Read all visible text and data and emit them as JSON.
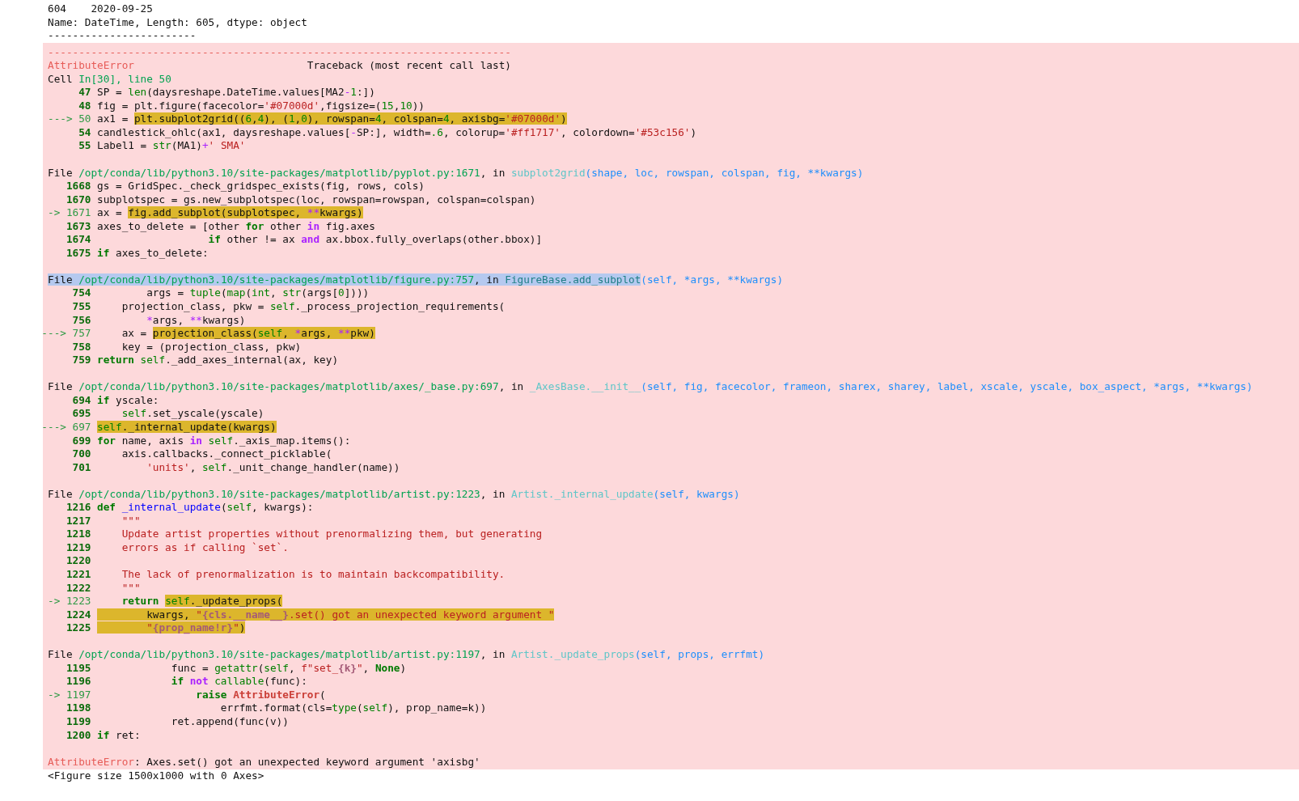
{
  "output_lines": [
    "604    2020-09-25",
    "Name: DateTime, Length: 605, dtype: object",
    "------------------------"
  ],
  "traceback": {
    "rule": "---------------------------------------------------------------------------",
    "header": [
      {
        "text": "AttributeError",
        "kind": "errname"
      },
      {
        "text": "                            Traceback (most recent call last)",
        "kind": "plain"
      }
    ],
    "frames": [
      {
        "location": [
          {
            "selected": false,
            "tokens": [
              {
                "text": "Cell ",
                "kind": "plain"
              },
              {
                "text": "In[30], line 50",
                "kind": "path"
              }
            ]
          }
        ],
        "lines": [
          {
            "number": "47",
            "current": false,
            "parts": [
              {
                "highlighted": false,
                "tokens": [
                  {
                    "text": "SP = ",
                    "kind": "plain"
                  },
                  {
                    "text": "len",
                    "kind": "builtin"
                  },
                  {
                    "text": "(daysreshape.DateTime.values[MA2",
                    "kind": "plain"
                  },
                  {
                    "text": "-",
                    "kind": "op"
                  },
                  {
                    "text": "1",
                    "kind": "number"
                  },
                  {
                    "text": ":])",
                    "kind": "plain"
                  }
                ]
              }
            ]
          },
          {
            "number": "48",
            "current": false,
            "parts": [
              {
                "highlighted": false,
                "tokens": [
                  {
                    "text": "fig = plt.figure(facecolor=",
                    "kind": "plain"
                  },
                  {
                    "text": "'#07000d'",
                    "kind": "string"
                  },
                  {
                    "text": ",figsize=(",
                    "kind": "plain"
                  },
                  {
                    "text": "15",
                    "kind": "number"
                  },
                  {
                    "text": ",",
                    "kind": "plain"
                  },
                  {
                    "text": "10",
                    "kind": "number"
                  },
                  {
                    "text": "))",
                    "kind": "plain"
                  }
                ]
              }
            ]
          },
          {
            "marker": "--->",
            "number": "50",
            "current": true,
            "parts": [
              {
                "highlighted": false,
                "tokens": [
                  {
                    "text": "ax1 = ",
                    "kind": "plain"
                  }
                ]
              },
              {
                "highlighted": true,
                "tokens": [
                  {
                    "text": "plt.subplot2grid((",
                    "kind": "plain"
                  },
                  {
                    "text": "6",
                    "kind": "number"
                  },
                  {
                    "text": ",",
                    "kind": "plain"
                  },
                  {
                    "text": "4",
                    "kind": "number"
                  },
                  {
                    "text": "), (",
                    "kind": "plain"
                  },
                  {
                    "text": "1",
                    "kind": "number"
                  },
                  {
                    "text": ",",
                    "kind": "plain"
                  },
                  {
                    "text": "0",
                    "kind": "number"
                  },
                  {
                    "text": "), rowspan=",
                    "kind": "plain"
                  },
                  {
                    "text": "4",
                    "kind": "number"
                  },
                  {
                    "text": ", colspan=",
                    "kind": "plain"
                  },
                  {
                    "text": "4",
                    "kind": "number"
                  },
                  {
                    "text": ", axisbg=",
                    "kind": "plain"
                  },
                  {
                    "text": "'#07000d'",
                    "kind": "string"
                  },
                  {
                    "text": ")",
                    "kind": "plain"
                  }
                ]
              }
            ]
          },
          {
            "number": "54",
            "current": false,
            "parts": [
              {
                "highlighted": false,
                "tokens": [
                  {
                    "text": "candlestick_ohlc(ax1, daysreshape.values[",
                    "kind": "plain"
                  },
                  {
                    "text": "-",
                    "kind": "op"
                  },
                  {
                    "text": "SP:], width=",
                    "kind": "plain"
                  },
                  {
                    "text": ".6",
                    "kind": "number"
                  },
                  {
                    "text": ", colorup=",
                    "kind": "plain"
                  },
                  {
                    "text": "'#ff1717'",
                    "kind": "string"
                  },
                  {
                    "text": ", colordown=",
                    "kind": "plain"
                  },
                  {
                    "text": "'#53c156'",
                    "kind": "string"
                  },
                  {
                    "text": ")",
                    "kind": "plain"
                  }
                ]
              }
            ]
          },
          {
            "number": "55",
            "current": false,
            "parts": [
              {
                "highlighted": false,
                "tokens": [
                  {
                    "text": "Label1 = ",
                    "kind": "plain"
                  },
                  {
                    "text": "str",
                    "kind": "builtin"
                  },
                  {
                    "text": "(MA1)",
                    "kind": "plain"
                  },
                  {
                    "text": "+",
                    "kind": "op"
                  },
                  {
                    "text": "' SMA'",
                    "kind": "string"
                  }
                ]
              }
            ]
          }
        ]
      },
      {
        "location": [
          {
            "selected": false,
            "tokens": [
              {
                "text": "File ",
                "kind": "plain"
              },
              {
                "text": "/opt/conda/lib/python3.10/site-packages/matplotlib/pyplot.py:1671",
                "kind": "path"
              },
              {
                "text": ", in ",
                "kind": "plain"
              },
              {
                "text": "subplot2grid",
                "kind": "func"
              },
              {
                "text": "(shape, loc, rowspan, colspan, fig, **kwargs)",
                "kind": "args"
              }
            ]
          }
        ],
        "lines": [
          {
            "number": "1668",
            "current": false,
            "parts": [
              {
                "highlighted": false,
                "tokens": [
                  {
                    "text": "gs = GridSpec._check_gridspec_exists(fig, rows, cols)",
                    "kind": "plain"
                  }
                ]
              }
            ]
          },
          {
            "number": "1670",
            "current": false,
            "parts": [
              {
                "highlighted": false,
                "tokens": [
                  {
                    "text": "subplotspec = gs.new_subplotspec(loc, rowspan=rowspan, colspan=colspan)",
                    "kind": "plain"
                  }
                ]
              }
            ]
          },
          {
            "marker": "->",
            "number": "1671",
            "current": true,
            "parts": [
              {
                "highlighted": false,
                "tokens": [
                  {
                    "text": "ax = ",
                    "kind": "plain"
                  }
                ]
              },
              {
                "highlighted": true,
                "tokens": [
                  {
                    "text": "fig.add_subplot(subplotspec, ",
                    "kind": "plain"
                  },
                  {
                    "text": "**",
                    "kind": "op"
                  },
                  {
                    "text": "kwargs)",
                    "kind": "plain"
                  }
                ]
              }
            ]
          },
          {
            "number": "1673",
            "current": false,
            "parts": [
              {
                "highlighted": false,
                "tokens": [
                  {
                    "text": "axes_to_delete = [other ",
                    "kind": "plain"
                  },
                  {
                    "text": "for",
                    "kind": "keyword"
                  },
                  {
                    "text": " other ",
                    "kind": "plain"
                  },
                  {
                    "text": "in",
                    "kind": "opword"
                  },
                  {
                    "text": " fig.axes",
                    "kind": "plain"
                  }
                ]
              }
            ]
          },
          {
            "number": "1674",
            "current": false,
            "parts": [
              {
                "highlighted": false,
                "tokens": [
                  {
                    "text": "                  if",
                    "kind": "keyword"
                  },
                  {
                    "text": " other != ax ",
                    "kind": "plain"
                  },
                  {
                    "text": "and",
                    "kind": "opword"
                  },
                  {
                    "text": " ax.bbox.fully_overlaps(other.bbox)]",
                    "kind": "plain"
                  }
                ]
              }
            ]
          },
          {
            "number": "1675",
            "current": false,
            "parts": [
              {
                "highlighted": false,
                "tokens": [
                  {
                    "text": "if",
                    "kind": "keyword"
                  },
                  {
                    "text": " axes_to_delete:",
                    "kind": "plain"
                  }
                ]
              }
            ]
          }
        ]
      },
      {
        "location": [
          {
            "selected": true,
            "tokens": [
              {
                "text": "File ",
                "kind": "plain"
              },
              {
                "text": "/opt/conda/lib/python3.10/site-packages/matplotlib/figure.py:757",
                "kind": "path"
              },
              {
                "text": ", in ",
                "kind": "plain"
              },
              {
                "text": "FigureBase.add_subplot",
                "kind": "func"
              }
            ]
          },
          {
            "selected": false,
            "tokens": [
              {
                "text": "(self, *args, **kwargs)",
                "kind": "args"
              }
            ]
          }
        ],
        "lines": [
          {
            "number": "754",
            "current": false,
            "parts": [
              {
                "highlighted": false,
                "tokens": [
                  {
                    "text": "        args = ",
                    "kind": "plain"
                  },
                  {
                    "text": "tuple",
                    "kind": "builtin"
                  },
                  {
                    "text": "(",
                    "kind": "plain"
                  },
                  {
                    "text": "map",
                    "kind": "builtin"
                  },
                  {
                    "text": "(",
                    "kind": "plain"
                  },
                  {
                    "text": "int",
                    "kind": "builtin"
                  },
                  {
                    "text": ", ",
                    "kind": "plain"
                  },
                  {
                    "text": "str",
                    "kind": "builtin"
                  },
                  {
                    "text": "(args[",
                    "kind": "plain"
                  },
                  {
                    "text": "0",
                    "kind": "number"
                  },
                  {
                    "text": "])))",
                    "kind": "plain"
                  }
                ]
              }
            ]
          },
          {
            "number": "755",
            "current": false,
            "parts": [
              {
                "highlighted": false,
                "tokens": [
                  {
                    "text": "    projection_class, pkw = ",
                    "kind": "plain"
                  },
                  {
                    "text": "self",
                    "kind": "self"
                  },
                  {
                    "text": "._process_projection_requirements(",
                    "kind": "plain"
                  }
                ]
              }
            ]
          },
          {
            "number": "756",
            "current": false,
            "parts": [
              {
                "highlighted": false,
                "tokens": [
                  {
                    "text": "        *",
                    "kind": "op"
                  },
                  {
                    "text": "args, ",
                    "kind": "plain"
                  },
                  {
                    "text": "**",
                    "kind": "op"
                  },
                  {
                    "text": "kwargs)",
                    "kind": "plain"
                  }
                ]
              }
            ]
          },
          {
            "marker": "--->",
            "number": "757",
            "current": true,
            "parts": [
              {
                "highlighted": false,
                "tokens": [
                  {
                    "text": "    ax = ",
                    "kind": "plain"
                  }
                ]
              },
              {
                "highlighted": true,
                "tokens": [
                  {
                    "text": "projection_class(",
                    "kind": "plain"
                  },
                  {
                    "text": "self",
                    "kind": "self"
                  },
                  {
                    "text": ", ",
                    "kind": "plain"
                  },
                  {
                    "text": "*",
                    "kind": "op"
                  },
                  {
                    "text": "args, ",
                    "kind": "plain"
                  },
                  {
                    "text": "**",
                    "kind": "op"
                  },
                  {
                    "text": "pkw)",
                    "kind": "plain"
                  }
                ]
              }
            ]
          },
          {
            "number": "758",
            "current": false,
            "parts": [
              {
                "highlighted": false,
                "tokens": [
                  {
                    "text": "    key = (projection_class, pkw)",
                    "kind": "plain"
                  }
                ]
              }
            ]
          },
          {
            "number": "759",
            "current": false,
            "parts": [
              {
                "highlighted": false,
                "tokens": [
                  {
                    "text": "return ",
                    "kind": "keyword"
                  },
                  {
                    "text": "self",
                    "kind": "self"
                  },
                  {
                    "text": "._add_axes_internal(ax, key)",
                    "kind": "plain"
                  }
                ]
              }
            ]
          }
        ]
      },
      {
        "location": [
          {
            "selected": false,
            "tokens": [
              {
                "text": "File ",
                "kind": "plain"
              },
              {
                "text": "/opt/conda/lib/python3.10/site-packages/matplotlib/axes/_base.py:697",
                "kind": "path"
              },
              {
                "text": ", in ",
                "kind": "plain"
              },
              {
                "text": "_AxesBase.__init__",
                "kind": "func"
              },
              {
                "text": "(self, fig, facecolor, frameon, sharex, sharey, label, xscale, yscale, box_aspect, *args, **kwargs)",
                "kind": "args"
              }
            ]
          }
        ],
        "lines": [
          {
            "number": "694",
            "current": false,
            "parts": [
              {
                "highlighted": false,
                "tokens": [
                  {
                    "text": "if",
                    "kind": "keyword"
                  },
                  {
                    "text": " yscale:",
                    "kind": "plain"
                  }
                ]
              }
            ]
          },
          {
            "number": "695",
            "current": false,
            "parts": [
              {
                "highlighted": false,
                "tokens": [
                  {
                    "text": "    self",
                    "kind": "self"
                  },
                  {
                    "text": ".set_yscale(yscale)",
                    "kind": "plain"
                  }
                ]
              }
            ]
          },
          {
            "marker": "--->",
            "number": "697",
            "current": true,
            "parts": [
              {
                "highlighted": true,
                "tokens": [
                  {
                    "text": "self",
                    "kind": "self"
                  },
                  {
                    "text": "._internal_update(kwargs)",
                    "kind": "plain"
                  }
                ]
              }
            ]
          },
          {
            "number": "699",
            "current": false,
            "parts": [
              {
                "highlighted": false,
                "tokens": [
                  {
                    "text": "for",
                    "kind": "keyword"
                  },
                  {
                    "text": " name, axis ",
                    "kind": "plain"
                  },
                  {
                    "text": "in",
                    "kind": "opword"
                  },
                  {
                    "text": " self",
                    "kind": "self"
                  },
                  {
                    "text": "._axis_map.items():",
                    "kind": "plain"
                  }
                ]
              }
            ]
          },
          {
            "number": "700",
            "current": false,
            "parts": [
              {
                "highlighted": false,
                "tokens": [
                  {
                    "text": "    axis.callbacks._connect_picklable(",
                    "kind": "plain"
                  }
                ]
              }
            ]
          },
          {
            "number": "701",
            "current": false,
            "parts": [
              {
                "highlighted": false,
                "tokens": [
                  {
                    "text": "        'units'",
                    "kind": "string"
                  },
                  {
                    "text": ", ",
                    "kind": "plain"
                  },
                  {
                    "text": "self",
                    "kind": "self"
                  },
                  {
                    "text": "._unit_change_handler(name))",
                    "kind": "plain"
                  }
                ]
              }
            ]
          }
        ]
      },
      {
        "location": [
          {
            "selected": false,
            "tokens": [
              {
                "text": "File ",
                "kind": "plain"
              },
              {
                "text": "/opt/conda/lib/python3.10/site-packages/matplotlib/artist.py:1223",
                "kind": "path"
              },
              {
                "text": ", in ",
                "kind": "plain"
              },
              {
                "text": "Artist._internal_update",
                "kind": "func"
              },
              {
                "text": "(self, kwargs)",
                "kind": "args"
              }
            ]
          }
        ],
        "lines": [
          {
            "number": "1216",
            "current": false,
            "parts": [
              {
                "highlighted": false,
                "tokens": [
                  {
                    "text": "def ",
                    "kind": "keyword"
                  },
                  {
                    "text": "_internal_update",
                    "kind": "defname"
                  },
                  {
                    "text": "(",
                    "kind": "plain"
                  },
                  {
                    "text": "self",
                    "kind": "self"
                  },
                  {
                    "text": ", kwargs):",
                    "kind": "plain"
                  }
                ]
              }
            ]
          },
          {
            "number": "1217",
            "current": false,
            "parts": [
              {
                "highlighted": false,
                "tokens": [
                  {
                    "text": "    \"\"\"",
                    "kind": "doc"
                  }
                ]
              }
            ]
          },
          {
            "number": "1218",
            "current": false,
            "parts": [
              {
                "highlighted": false,
                "tokens": [
                  {
                    "text": "    Update artist properties without prenormalizing them, but generating",
                    "kind": "doc"
                  }
                ]
              }
            ]
          },
          {
            "number": "1219",
            "current": false,
            "parts": [
              {
                "highlighted": false,
                "tokens": [
                  {
                    "text": "    errors as if calling `set`.",
                    "kind": "doc"
                  }
                ]
              }
            ]
          },
          {
            "number": "1220",
            "current": false
          },
          {
            "number": "1221",
            "current": false,
            "parts": [
              {
                "highlighted": false,
                "tokens": [
                  {
                    "text": "    The lack of prenormalization is to maintain backcompatibility.",
                    "kind": "doc"
                  }
                ]
              }
            ]
          },
          {
            "number": "1222",
            "current": false,
            "parts": [
              {
                "highlighted": false,
                "tokens": [
                  {
                    "text": "    \"\"\"",
                    "kind": "doc"
                  }
                ]
              }
            ]
          },
          {
            "marker": "->",
            "number": "1223",
            "current": true,
            "parts": [
              {
                "highlighted": false,
                "tokens": [
                  {
                    "text": "    return ",
                    "kind": "keyword"
                  }
                ]
              },
              {
                "highlighted": true,
                "tokens": [
                  {
                    "text": "self",
                    "kind": "self"
                  },
                  {
                    "text": "._update_props(",
                    "kind": "plain"
                  }
                ]
              }
            ]
          },
          {
            "number": "1224",
            "current": false,
            "parts": [
              {
                "highlighted": true,
                "tokens": [
                  {
                    "text": "        kwargs, ",
                    "kind": "plain"
                  },
                  {
                    "text": "\"",
                    "kind": "string"
                  },
                  {
                    "text": "{cls.__name__}",
                    "kind": "interp"
                  },
                  {
                    "text": ".set() got an unexpected keyword argument \"",
                    "kind": "string"
                  }
                ]
              }
            ]
          },
          {
            "number": "1225",
            "current": false,
            "parts": [
              {
                "highlighted": true,
                "tokens": [
                  {
                    "text": "        \"",
                    "kind": "string"
                  },
                  {
                    "text": "{prop_name!r}",
                    "kind": "interp"
                  },
                  {
                    "text": "\"",
                    "kind": "string"
                  },
                  {
                    "text": ")",
                    "kind": "plain"
                  }
                ]
              }
            ]
          }
        ]
      },
      {
        "location": [
          {
            "selected": false,
            "tokens": [
              {
                "text": "File ",
                "kind": "plain"
              },
              {
                "text": "/opt/conda/lib/python3.10/site-packages/matplotlib/artist.py:1197",
                "kind": "path"
              },
              {
                "text": ", in ",
                "kind": "plain"
              },
              {
                "text": "Artist._update_props",
                "kind": "func"
              },
              {
                "text": "(self, props, errfmt)",
                "kind": "args"
              }
            ]
          }
        ],
        "lines": [
          {
            "number": "1195",
            "current": false,
            "parts": [
              {
                "highlighted": false,
                "tokens": [
                  {
                    "text": "            func = ",
                    "kind": "plain"
                  },
                  {
                    "text": "getattr",
                    "kind": "builtin"
                  },
                  {
                    "text": "(",
                    "kind": "plain"
                  },
                  {
                    "text": "self",
                    "kind": "self"
                  },
                  {
                    "text": ", ",
                    "kind": "plain"
                  },
                  {
                    "text": "f\"set_",
                    "kind": "string"
                  },
                  {
                    "text": "{k}",
                    "kind": "interp"
                  },
                  {
                    "text": "\"",
                    "kind": "string"
                  },
                  {
                    "text": ", ",
                    "kind": "plain"
                  },
                  {
                    "text": "None",
                    "kind": "keyword"
                  },
                  {
                    "text": ")",
                    "kind": "plain"
                  }
                ]
              }
            ]
          },
          {
            "number": "1196",
            "current": false,
            "parts": [
              {
                "highlighted": false,
                "tokens": [
                  {
                    "text": "            if ",
                    "kind": "keyword"
                  },
                  {
                    "text": "not ",
                    "kind": "opword"
                  },
                  {
                    "text": "callable",
                    "kind": "builtin"
                  },
                  {
                    "text": "(func):",
                    "kind": "plain"
                  }
                ]
              }
            ]
          },
          {
            "marker": "->",
            "number": "1197",
            "current": true,
            "parts": [
              {
                "highlighted": false,
                "tokens": [
                  {
                    "text": "                raise ",
                    "kind": "keyword"
                  },
                  {
                    "text": "AttributeError",
                    "kind": "exception"
                  },
                  {
                    "text": "(",
                    "kind": "plain"
                  }
                ]
              }
            ]
          },
          {
            "number": "1198",
            "current": false,
            "parts": [
              {
                "highlighted": false,
                "tokens": [
                  {
                    "text": "                    errfmt.format(cls=",
                    "kind": "plain"
                  },
                  {
                    "text": "type",
                    "kind": "builtin"
                  },
                  {
                    "text": "(",
                    "kind": "plain"
                  },
                  {
                    "text": "self",
                    "kind": "self"
                  },
                  {
                    "text": "), prop_name=k))",
                    "kind": "plain"
                  }
                ]
              }
            ]
          },
          {
            "number": "1199",
            "current": false,
            "parts": [
              {
                "highlighted": false,
                "tokens": [
                  {
                    "text": "            ret.append(func(v))",
                    "kind": "plain"
                  }
                ]
              }
            ]
          },
          {
            "number": "1200",
            "current": false,
            "parts": [
              {
                "highlighted": false,
                "tokens": [
                  {
                    "text": "if",
                    "kind": "keyword"
                  },
                  {
                    "text": " ret:",
                    "kind": "plain"
                  }
                ]
              }
            ]
          }
        ]
      }
    ],
    "message": [
      {
        "text": "AttributeError",
        "kind": "errname"
      },
      {
        "text": ": Axes.set() got an unexpected keyword argument 'axisbg'",
        "kind": "plain"
      }
    ]
  },
  "figure_repr": "<Figure size 1500x1000 with 0 Axes>"
}
